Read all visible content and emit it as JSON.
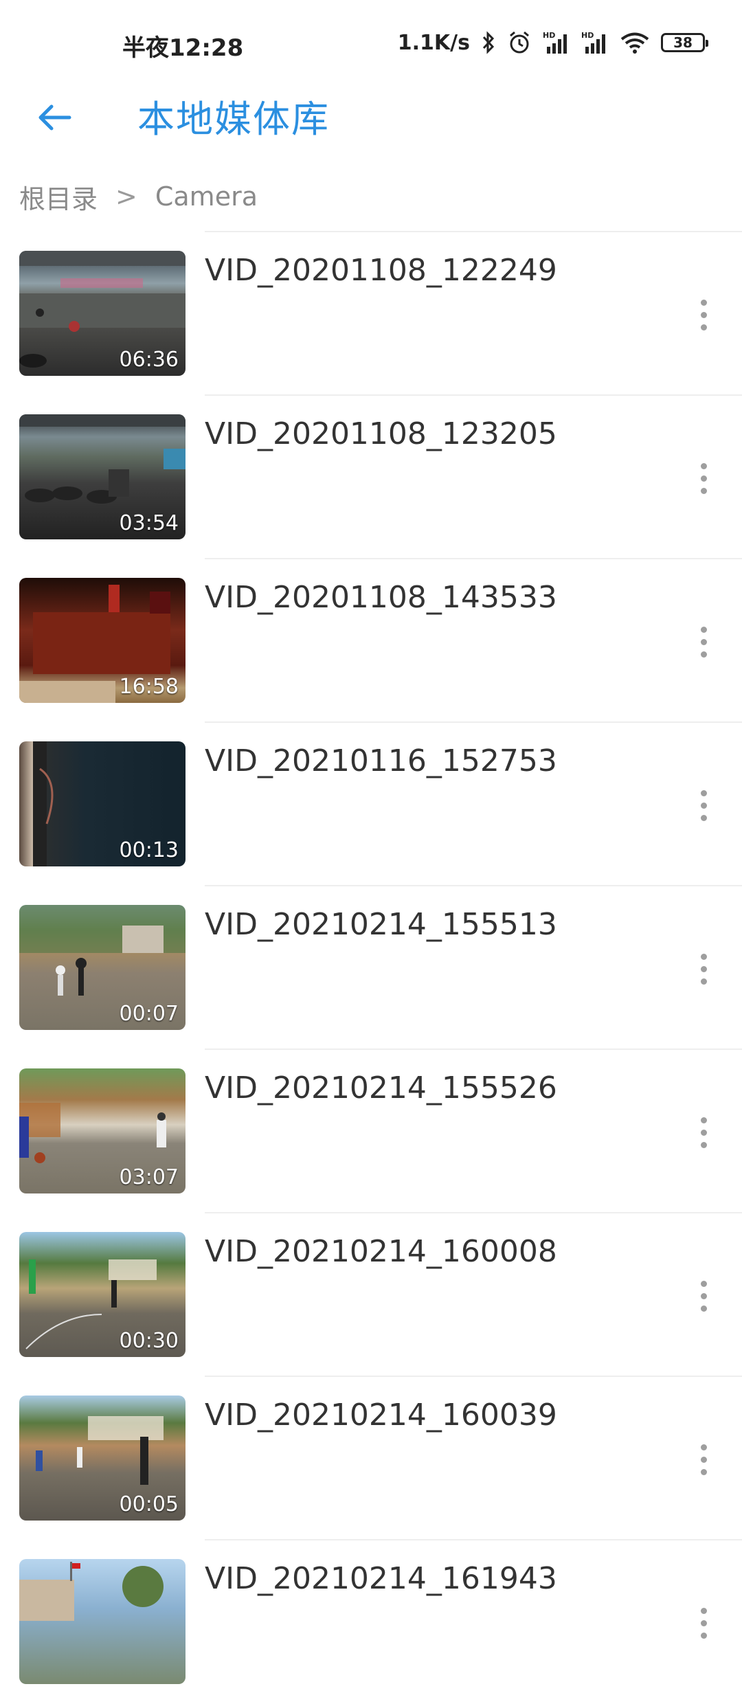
{
  "status_bar": {
    "time": "半夜12:28",
    "speed": "1.1K/s",
    "battery": "38",
    "icons": [
      "bluetooth-icon",
      "alarm-icon",
      "signal-hd-icon",
      "signal-hd-icon",
      "wifi-icon",
      "battery-icon"
    ]
  },
  "header": {
    "title": "本地媒体库",
    "back_icon": "arrow-left-icon",
    "accent_color": "#2b8fe0"
  },
  "breadcrumb": {
    "root": "根目录",
    "separator": ">",
    "current": "Camera"
  },
  "videos": [
    {
      "name": "VID_20201108_122249",
      "duration": "06:36"
    },
    {
      "name": "VID_20201108_123205",
      "duration": "03:54"
    },
    {
      "name": "VID_20201108_143533",
      "duration": "16:58"
    },
    {
      "name": "VID_20210116_152753",
      "duration": "00:13"
    },
    {
      "name": "VID_20210214_155513",
      "duration": "00:07"
    },
    {
      "name": "VID_20210214_155526",
      "duration": "03:07"
    },
    {
      "name": "VID_20210214_160008",
      "duration": "00:30"
    },
    {
      "name": "VID_20210214_160039",
      "duration": "00:05"
    },
    {
      "name": "VID_20210214_161943",
      "duration": ""
    }
  ]
}
